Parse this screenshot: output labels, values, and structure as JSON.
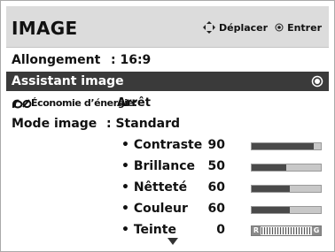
{
  "header": {
    "title": "IMAGE",
    "move_hint": "Déplacer",
    "enter_hint": "Entrer"
  },
  "menu": {
    "aspect": {
      "label": "Allongement",
      "value": ": 16:9"
    },
    "assistant": {
      "label": "Assistant image",
      "selected": true
    },
    "energy": {
      "label": "Économie d’énergie:",
      "value": "Arrêt"
    },
    "mode": {
      "label": "Mode image",
      "value": ": Standard"
    }
  },
  "sliders": [
    {
      "name": "• Contraste",
      "value": "90",
      "level": 0.9
    },
    {
      "name": "• Brillance",
      "value": "50",
      "level": 0.5
    },
    {
      "name": "• Nêtteté",
      "value": "60",
      "level": 0.55
    },
    {
      "name": "• Couleur",
      "value": "60",
      "level": 0.55
    }
  ],
  "tint": {
    "name": "• Teinte",
    "value": "0",
    "left_label": "R",
    "right_label": "G"
  },
  "colors": {
    "header_bg": "#dcdcdc",
    "highlight_bg": "#3a3a3a",
    "bar_fill": "#4a4a4a",
    "bar_track": "#c8c8c8"
  },
  "icons": {
    "nav": "dpad-icon",
    "enter": "ok-icon",
    "energy": "eco-icon",
    "selected": "radio-selected-icon",
    "more": "arrow-down-icon"
  }
}
